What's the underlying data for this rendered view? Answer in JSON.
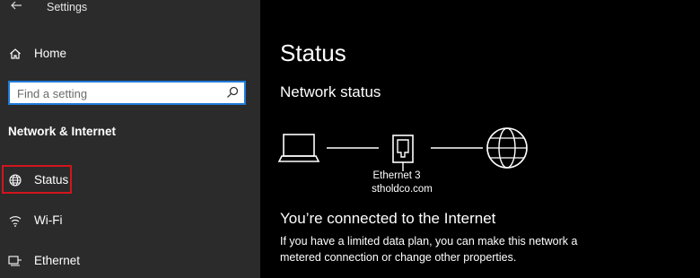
{
  "titlebar": {
    "title": "Settings",
    "back_icon": "arrow-left-icon"
  },
  "sidebar": {
    "home": {
      "label": "Home",
      "icon": "home-icon"
    },
    "search": {
      "placeholder": "Find a setting",
      "value": "",
      "icon": "search-icon"
    },
    "section_title": "Network & Internet",
    "items": [
      {
        "label": "Status",
        "icon": "globe-icon",
        "selected": true
      },
      {
        "label": "Wi-Fi",
        "icon": "wifi-icon"
      },
      {
        "label": "Ethernet",
        "icon": "ethernet-icon"
      }
    ]
  },
  "main": {
    "title": "Status",
    "network_status_heading": "Network status",
    "adapter": {
      "name": "Ethernet 3",
      "network": "stholdco.com"
    },
    "connected_heading": "You’re connected to the Internet",
    "description": "If you have a limited data plan, you can make this network a metered connection or change other properties."
  },
  "colors": {
    "sidebar_bg": "#2b2b2b",
    "main_bg": "#000000",
    "accent": "#1f7ad8",
    "highlight": "#d2151d"
  }
}
